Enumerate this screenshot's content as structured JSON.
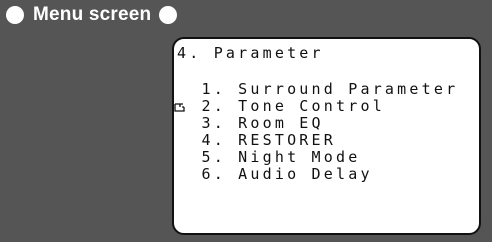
{
  "header": {
    "title": "Menu screen"
  },
  "screen": {
    "heading": "4. Parameter",
    "items": [
      {
        "label": "  1. Surround Parameter"
      },
      {
        "label": "  2. Tone Control",
        "selected": true
      },
      {
        "label": "  3. Room EQ"
      },
      {
        "label": "  4. RESTORER"
      },
      {
        "label": "  5. Night Mode"
      },
      {
        "label": "  6. Audio Delay"
      }
    ],
    "cursor_icon": "pointing-hand-icon"
  },
  "colors": {
    "panel": "#555555",
    "screen_bg": "#ffffff",
    "text": "#111111"
  }
}
